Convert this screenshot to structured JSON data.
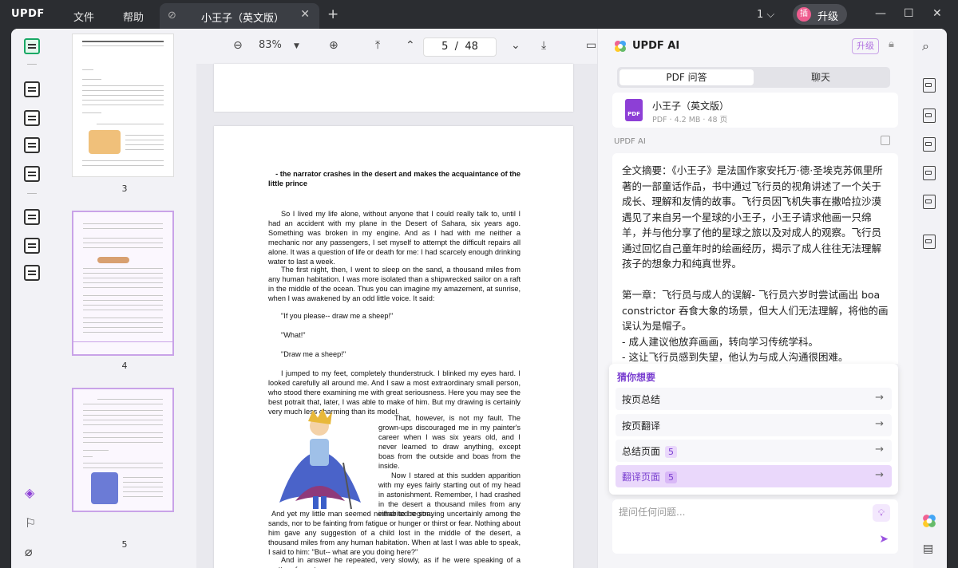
{
  "titlebar": {
    "logo": "UPDF",
    "menu": [
      "文件",
      "帮助"
    ],
    "tab_title": "小王子（英文版）",
    "window_count": "1",
    "upgrade_label": "升级",
    "avatar_letter": "插"
  },
  "thumbnails": [
    {
      "page": "3"
    },
    {
      "page": "4"
    },
    {
      "page": "5"
    }
  ],
  "viewer": {
    "zoom": "83%",
    "current_page": "5",
    "total_pages": "48",
    "page_sep": "/",
    "heading_line1": "- the narrator crashes in the desert and makes the acquaintance of the",
    "heading_line2": "little prince",
    "paragraphs": [
      "So I lived my life alone, without anyone that I could really talk to, until I had an accident with my plane in the Desert of Sahara, six years ago. Something was broken in my engine. And as I had with me neither a mechanic nor any passengers, I set myself to attempt the difficult repairs all alone. It was a question of life or death for me: I had scarcely enough drinking water to last a week.",
      "The first night, then, I went to sleep on the sand, a thousand miles from any human habitation. I was more isolated than a shipwrecked sailor on a raft in the middle of the ocean. Thus you can imagine my amazement, at sunrise, when I was awakened by an odd little voice. It said:",
      "\"If you please-- draw me a sheep!\"",
      "\"What!\"",
      "\"Draw me a sheep!\"",
      "I jumped to my feet, completely thunderstruck. I blinked my eyes hard. I looked carefully all around me. And I saw a most extraordinary small person, who stood there examining me with great seriousness. Here you may see the best potrait that, later, I was able to make of him. But my drawing is certainly very much less charming than its model.",
      "That, however, is not my fault. The grown-ups discouraged me in my painter's career when I was six years old, and I never learned to draw anything, except boas from the outside and boas from the inside.",
      "Now I stared at this sudden apparition with my eyes fairly starting out of my head in astonishment. Remember, I had crashed in the desert a thousand miles from any inhabited region.",
      "And yet my little man seemed neither to be straying uncertainly among the sands, nor to be fainting from fatigue or hunger or thirst or fear. Nothing about him gave any suggestion of a child lost in the middle of the desert, a thousand miles from any human habitation. When at last I was able to speak, I said to him: \"But-- what are you doing here?\"",
      "And in answer he repeated, very slowly, as if he were speaking of a matter of great"
    ]
  },
  "ai": {
    "title": "UPDF AI",
    "upgrade_btn": "升级",
    "tabs": [
      "PDF 问答",
      "聊天"
    ],
    "file_name": "小王子（英文版）",
    "file_meta": "PDF · 4.2 MB · 48 页",
    "label": "UPDF AI",
    "answer": "全文摘要：《小王子》是法国作家安托万·德·圣埃克苏佩里所著的一部童话作品，书中通过飞行员的视角讲述了一个关于成长、理解和友情的故事。飞行员因飞机失事在撒哈拉沙漠遇见了来自另一个星球的小王子，小王子请求他画一只绵羊，并与他分享了他的星球之旅以及对成人的观察。飞行员通过回忆自己童年时的绘画经历，揭示了成人往往无法理解孩子的想象力和纯真世界。\n\n第一章：飞行员与成人的误解- 飞行员六岁时尝试画出 boa constrictor 吞食大象的场景，但大人们无法理解，将他的画误认为是帽子。\n- 成人建议他放弃画画，转向学习传统学科。\n- 这让飞行员感到失望，他认为与成人沟通很困难。\n\n第二章：飞行员在沙漠的奇遇\n- 飞行员在撒哈拉沙漠遭遇飞机故障，独自一人试图修复。",
    "suggest_title": "猜你想要",
    "suggestions": [
      {
        "label": "按页总结",
        "badge": ""
      },
      {
        "label": "按页翻译",
        "badge": ""
      },
      {
        "label": "总结页面",
        "badge": "5"
      },
      {
        "label": "翻译页面",
        "badge": "5"
      }
    ],
    "input_placeholder": "提问任何问题..."
  },
  "colors": {
    "accent": "#8d3fd6",
    "highlight": "#ead8fb",
    "active_tool": "#19a865"
  }
}
